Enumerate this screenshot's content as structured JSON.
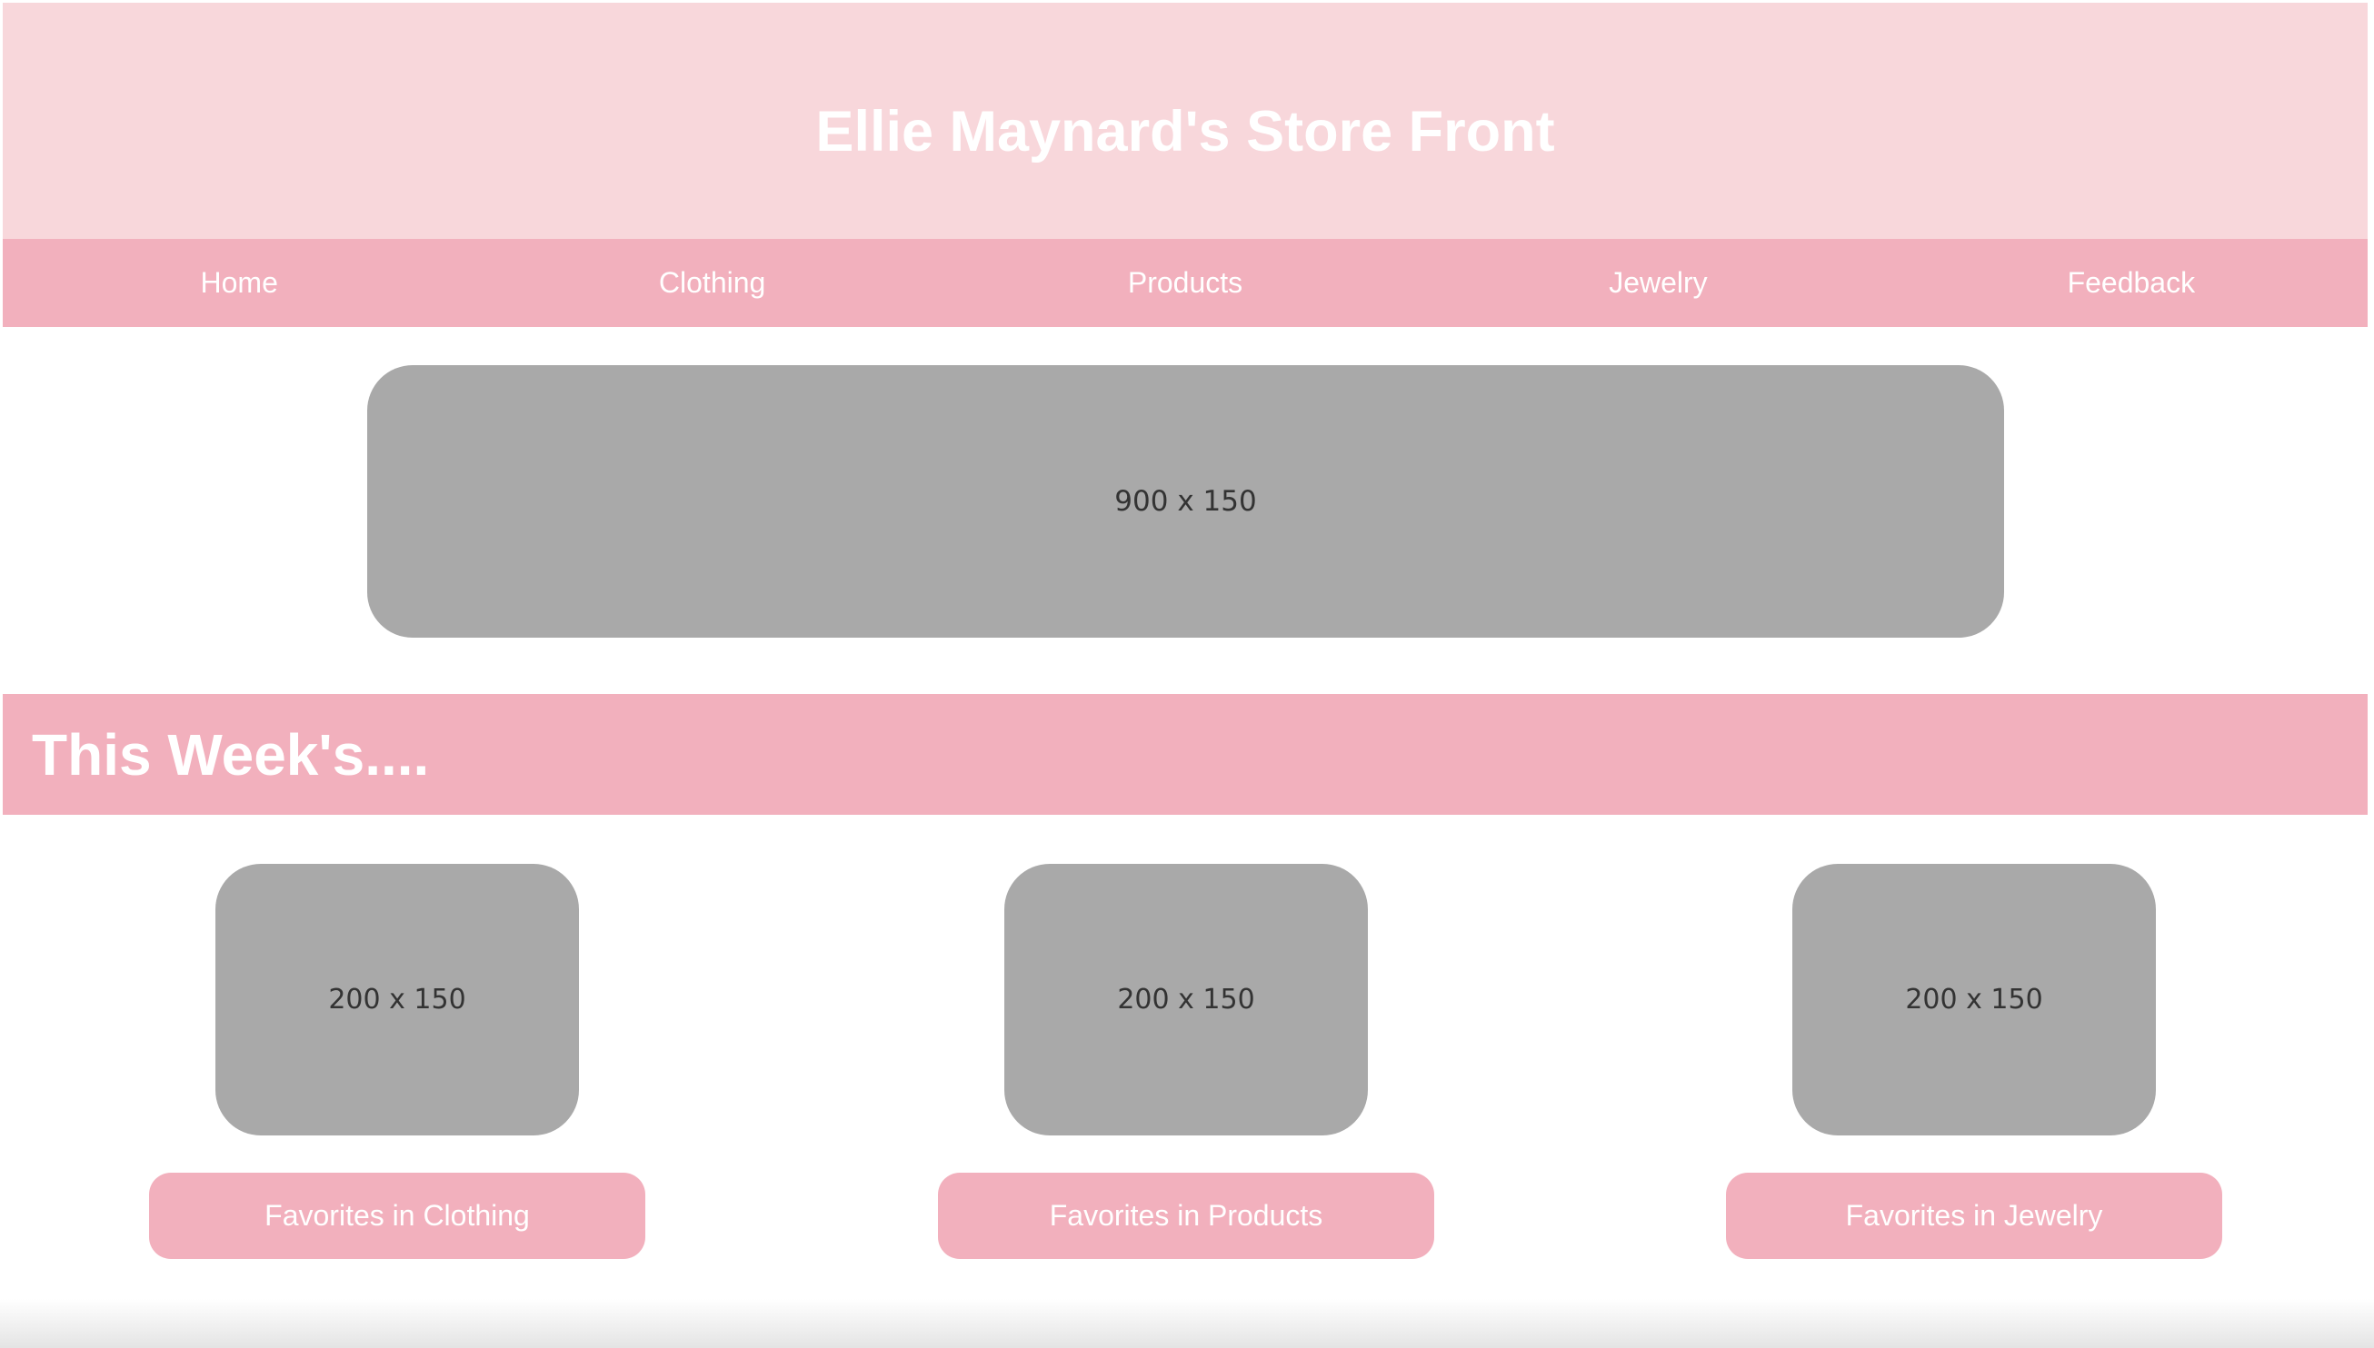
{
  "header": {
    "title": "Ellie Maynard's Store Front"
  },
  "nav": {
    "items": [
      {
        "label": "Home"
      },
      {
        "label": "Clothing"
      },
      {
        "label": "Products"
      },
      {
        "label": "Jewelry"
      },
      {
        "label": "Feedback"
      }
    ]
  },
  "banner": {
    "placeholder": "900 x 150"
  },
  "weekly": {
    "heading": "This Week's....",
    "cards": [
      {
        "placeholder": "200 x 150",
        "button_label": "Favorites in Clothing"
      },
      {
        "placeholder": "200 x 150",
        "button_label": "Favorites in Products"
      },
      {
        "placeholder": "200 x 150",
        "button_label": "Favorites in Jewelry"
      }
    ]
  },
  "colors": {
    "header_bg": "#f8d7db",
    "accent_pink": "#f2b0bd",
    "placeholder_gray": "#a9a9a9",
    "text_white": "#ffffff"
  }
}
